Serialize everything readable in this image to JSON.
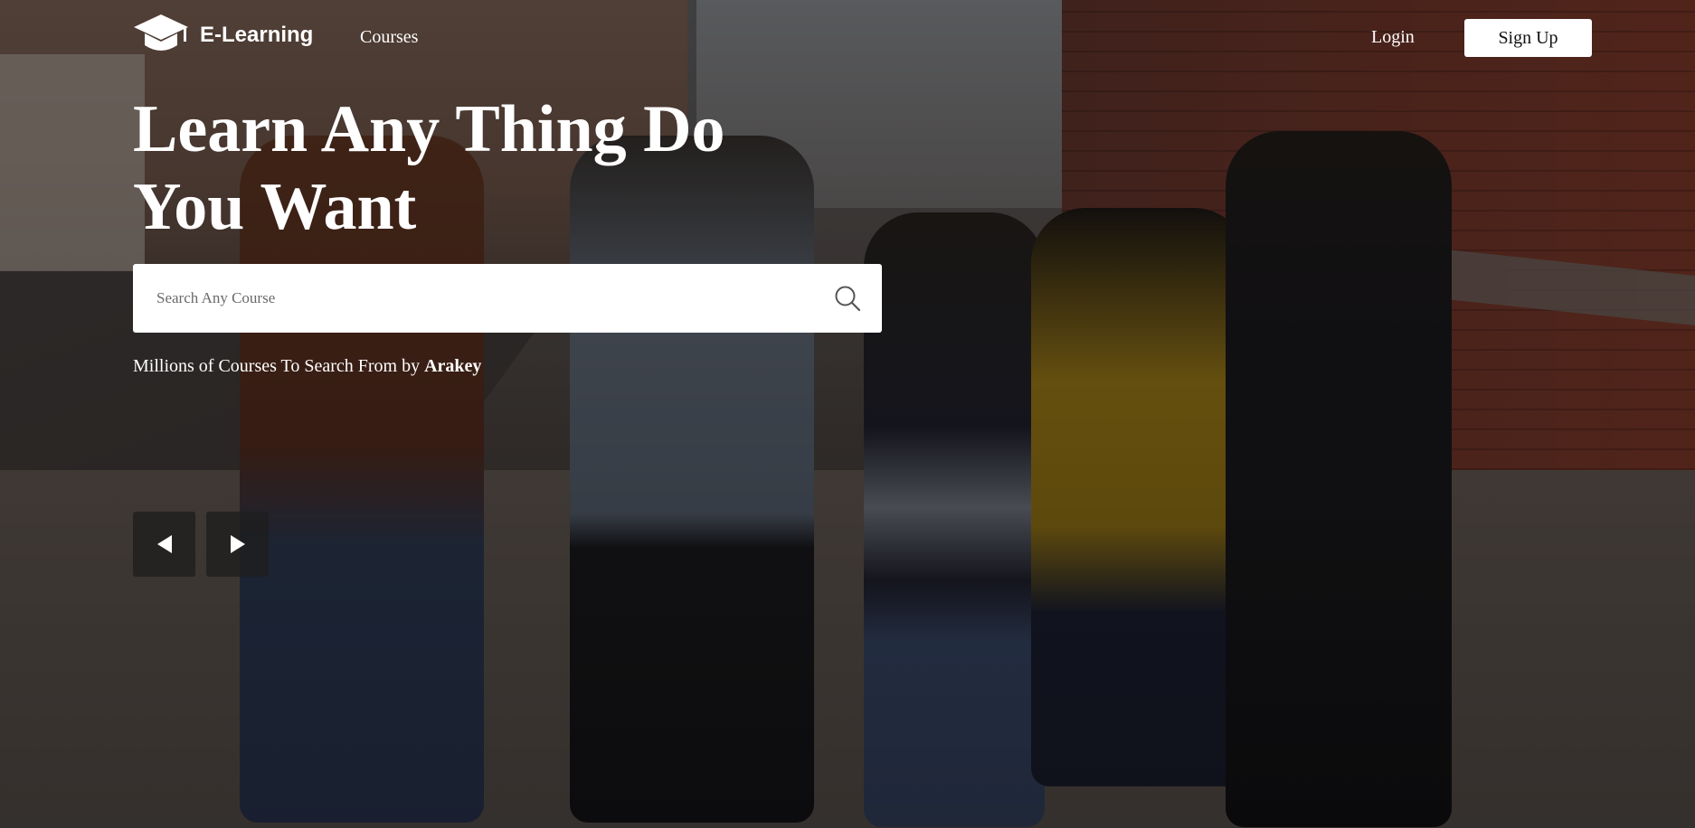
{
  "brand": {
    "name": "E-Learning",
    "icon": "graduation-cap-icon"
  },
  "nav": {
    "courses": "Courses",
    "login": "Login",
    "signup": "Sign Up"
  },
  "hero": {
    "title_line1": "Learn Any Thing Do",
    "title_line2": "You Want",
    "search": {
      "placeholder": "Search Any Course",
      "value": "",
      "icon": "search-icon"
    },
    "tagline_prefix": "Millions of Courses To Search From by ",
    "tagline_brand": "Arakey"
  },
  "slider": {
    "prev_icon": "triangle-left-icon",
    "next_icon": "triangle-right-icon"
  },
  "colors": {
    "text": "#ffffff",
    "button_bg": "#ffffff",
    "control_bg": "#1e1e1e"
  }
}
